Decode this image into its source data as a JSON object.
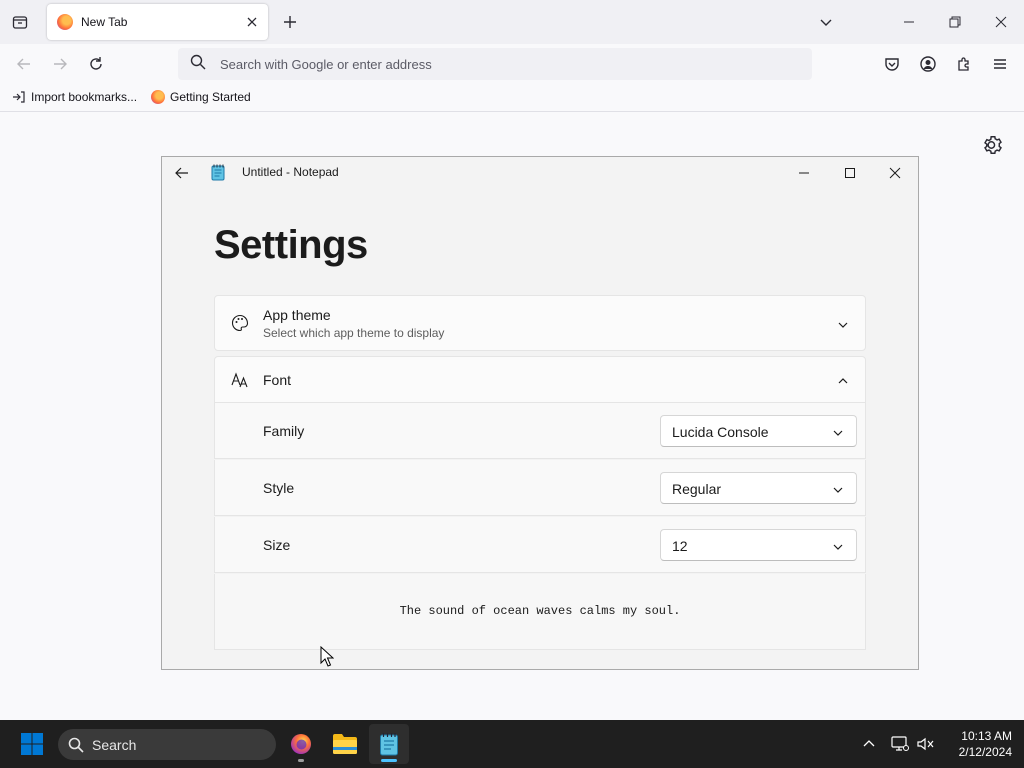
{
  "browser": {
    "tab": {
      "title": "New Tab"
    },
    "urlbar": {
      "placeholder": "Search with Google or enter address"
    },
    "bookmarks": [
      {
        "label": "Import bookmarks..."
      },
      {
        "label": "Getting Started"
      }
    ],
    "icons": [
      "tab-list-icon",
      "firefox-icon",
      "close-icon",
      "plus-icon",
      "chevron-down-icon",
      "minimize-icon",
      "restore-icon",
      "back-icon",
      "forward-icon",
      "reload-icon",
      "search-icon",
      "pocket-icon",
      "account-icon",
      "extensions-icon",
      "menu-icon",
      "import-icon",
      "gear-icon"
    ]
  },
  "notepad": {
    "window_title": "Untitled - Notepad",
    "heading": "Settings",
    "app_theme": {
      "title": "App theme",
      "subtitle": "Select which app theme to display"
    },
    "font": {
      "title": "Font",
      "rows": [
        {
          "label": "Family",
          "value": "Lucida Console"
        },
        {
          "label": "Style",
          "value": "Regular"
        },
        {
          "label": "Size",
          "value": "12"
        }
      ],
      "preview": "The sound of ocean waves calms my soul."
    }
  },
  "taskbar": {
    "search_label": "Search",
    "time": "10:13 AM",
    "date": "2/12/2024"
  },
  "colors": {
    "taskbar_bg": "#1f1f1f",
    "windows_blue": "#0078d4",
    "indicator": "#4cc2ff"
  }
}
